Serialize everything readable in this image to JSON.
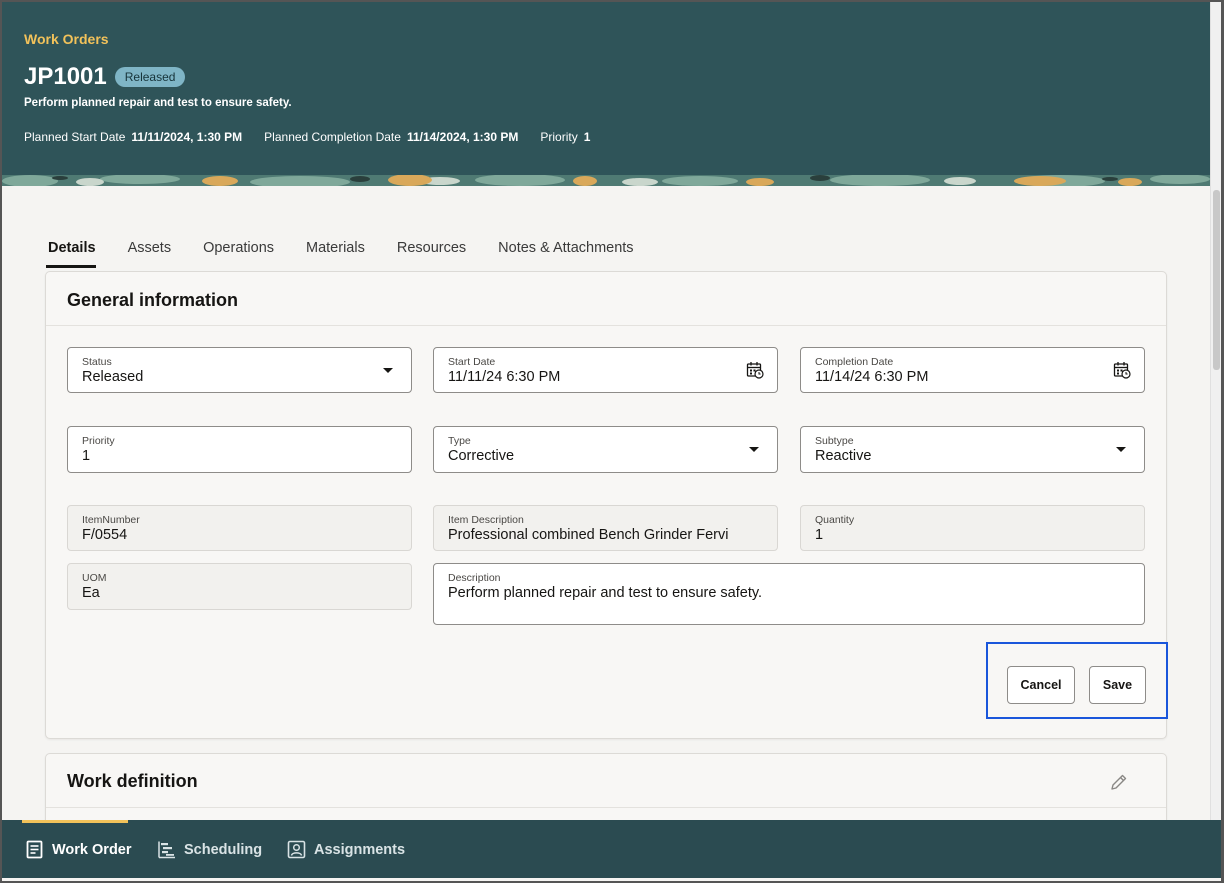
{
  "header": {
    "breadcrumb": "Work Orders",
    "title": "JP1001",
    "status_badge": "Released",
    "subtitle": "Perform planned repair and test to ensure safety.",
    "meta": [
      {
        "label": "Planned Start Date",
        "value": "11/11/2024, 1:30 PM"
      },
      {
        "label": "Planned Completion Date",
        "value": "11/14/2024, 1:30 PM"
      },
      {
        "label": "Priority",
        "value": "1"
      }
    ]
  },
  "tabs": [
    {
      "label": "Details",
      "active": true
    },
    {
      "label": "Assets"
    },
    {
      "label": "Operations"
    },
    {
      "label": "Materials"
    },
    {
      "label": "Resources"
    },
    {
      "label": "Notes & Attachments"
    }
  ],
  "general": {
    "title": "General information",
    "fields": {
      "status": {
        "label": "Status",
        "value": "Released"
      },
      "start_date": {
        "label": "Start Date",
        "value": "11/11/24 6:30 PM"
      },
      "completion_date": {
        "label": "Completion Date",
        "value": "11/14/24 6:30 PM"
      },
      "priority": {
        "label": "Priority",
        "value": "1"
      },
      "type": {
        "label": "Type",
        "value": "Corrective"
      },
      "subtype": {
        "label": "Subtype",
        "value": "Reactive"
      },
      "item_number": {
        "label": "ItemNumber",
        "value": "F/0554"
      },
      "item_description": {
        "label": "Item Description",
        "value": "Professional combined Bench Grinder Fervi"
      },
      "quantity": {
        "label": "Quantity",
        "value": "1"
      },
      "uom": {
        "label": "UOM",
        "value": "Ea"
      },
      "description": {
        "label": "Description",
        "value": "Perform planned repair and test to ensure safety."
      }
    },
    "cancel_label": "Cancel",
    "save_label": "Save"
  },
  "work_definition": {
    "title": "Work definition"
  },
  "bottom_nav": [
    {
      "label": "Work Order",
      "icon": "document-icon",
      "active": true
    },
    {
      "label": "Scheduling",
      "icon": "gantt-icon"
    },
    {
      "label": "Assignments",
      "icon": "person-badge-icon"
    }
  ],
  "colors": {
    "header_bg": "#2f5459",
    "accent": "#f2c25a",
    "badge": "#7fb5c6",
    "bottom_nav_bg": "#2b4b51",
    "focus_outline": "#1a56db"
  }
}
